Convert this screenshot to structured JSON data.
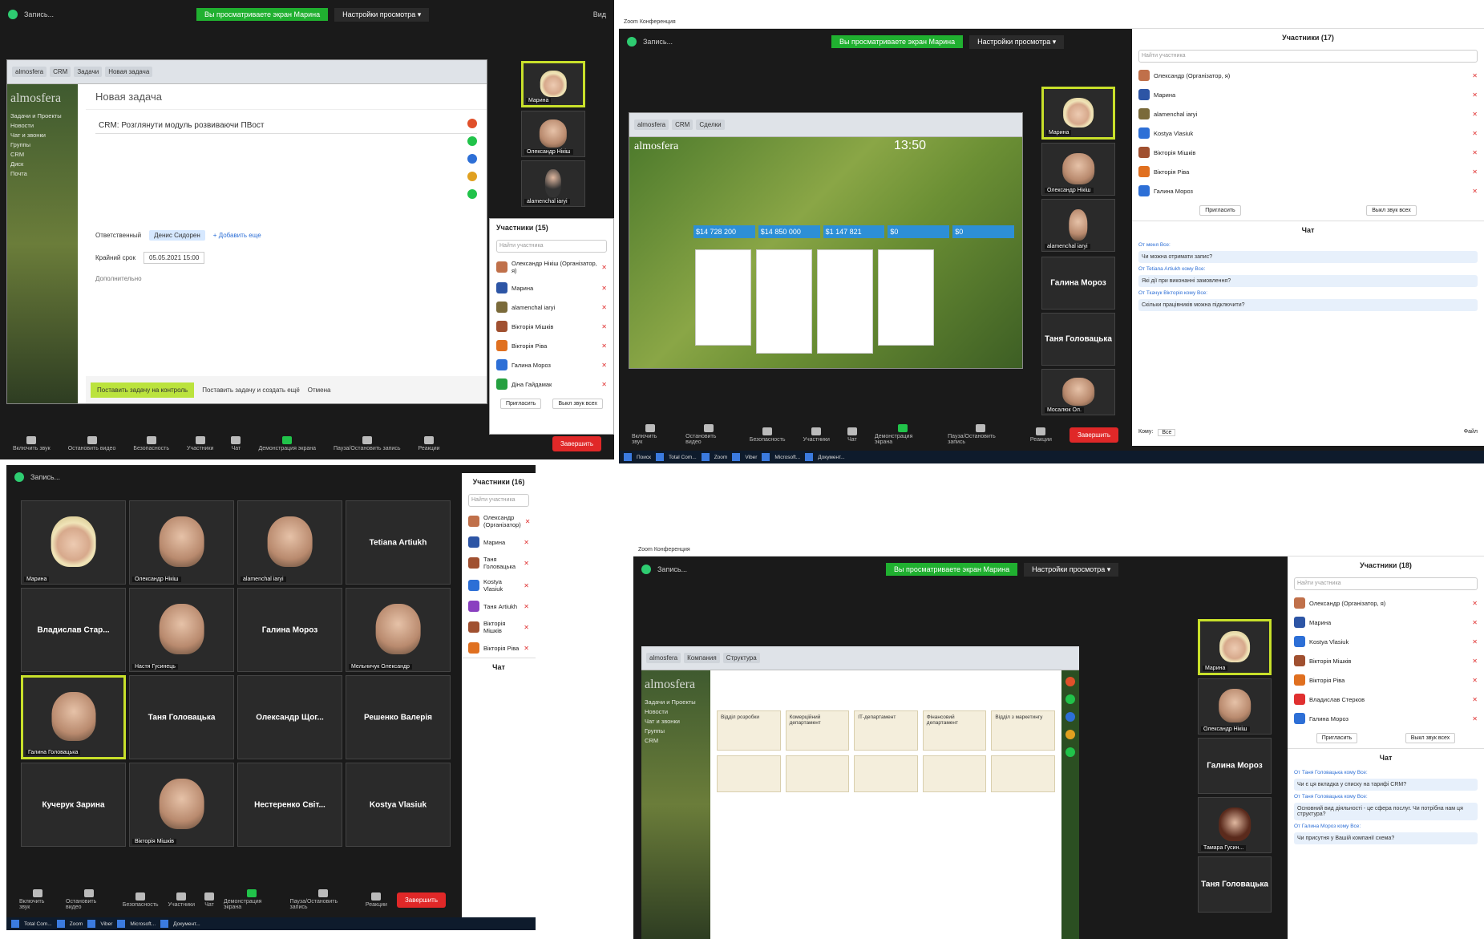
{
  "common": {
    "window_title": "Zoom Конференция",
    "view_banner": "Вы просматриваете экран Марина",
    "view_settings": "Настройки просмотра ▾",
    "view_label": "Вид",
    "recording": "Запись...",
    "end_button": "Завершить",
    "participants_title_17": "Участники (17)",
    "participants_title_16": "Участники (16)",
    "participants_title_18": "Участники (18)",
    "search_placeholder": "Найти участника",
    "invite": "Пригласить",
    "mute_all": "Выкл звук всех",
    "chat_title": "Чат",
    "chat_to": "Кому:",
    "chat_to_value": "Все",
    "chat_file": "Файл",
    "logo": "almosfera",
    "controls": [
      "Включить звук",
      "Остановить видео",
      "Безопасность",
      "Участники",
      "Чат",
      "Демонстрация экрана",
      "Пауза/Остановить запись",
      "Реакции"
    ]
  },
  "tl": {
    "task_header": "Новая задача",
    "task_title": "CRM: Розглянути модуль розвиваючи ПВост",
    "responsible_label": "Ответственный",
    "responsible_value": "Денис Сидорен",
    "add_more": "+ Добавить еще",
    "deadline_label": "Крайний срок",
    "deadline_value": "05.05.2021 15:00",
    "additional": "Дополнительно",
    "save_button": "Поставить задачу на контроль",
    "create_another": "Поставить задачу и создать ещё",
    "cancel": "Отмена",
    "participants_count": "Участники (15)",
    "participants": [
      {
        "name": "Олександр Нікіш (Організатор, я)",
        "color": "#c0704a"
      },
      {
        "name": "Марина",
        "color": "#2d55a5"
      },
      {
        "name": "alamenchal iaryi",
        "color": "#7a6a3a"
      },
      {
        "name": "Вікторія Мішків",
        "color": "#a05030"
      },
      {
        "name": "Вікторія Ріва",
        "color": "#e07020"
      },
      {
        "name": "Галина Мороз",
        "color": "#2d6fd6"
      },
      {
        "name": "Діна Гайдамак",
        "color": "#25a040"
      }
    ],
    "videos": [
      "Марина",
      "Олександр Нікіш",
      "alamenchal iaryi"
    ]
  },
  "tr": {
    "time": "13:50",
    "participants": [
      {
        "name": "Олександр (Організатор, я)",
        "color": "#c0704a"
      },
      {
        "name": "Марина",
        "color": "#2d55a5"
      },
      {
        "name": "alamenchal iaryi",
        "color": "#7a6a3a"
      },
      {
        "name": "Kostya Vlasiuk",
        "color": "#2d6fd6"
      },
      {
        "name": "Вікторія Мішків",
        "color": "#a05030"
      },
      {
        "name": "Вікторія Ріва",
        "color": "#e07020"
      },
      {
        "name": "Галина Мороз",
        "color": "#2d6fd6"
      }
    ],
    "videos": [
      "Марина",
      "Олександр Нікіш",
      "alamenchal iaryi"
    ],
    "tiles": [
      "Галина Мороз",
      "Таня Головацька"
    ],
    "last_video": "Мосалюк Ол.",
    "amounts": [
      "$14 728 200",
      "$14 850 000",
      "$1 147 821",
      "$0",
      "$0"
    ],
    "chat": [
      {
        "meta": "От меня Все:",
        "text": "Чи можна отримати запис?"
      },
      {
        "meta": "От Tetiana Artiukh кому Все:",
        "text": "Які дії при виконанні замовлення?"
      },
      {
        "meta": "От Ткачук Вікторія кому Все:",
        "text": "Скільки працівників можна підключити?"
      }
    ]
  },
  "bl": {
    "grid": [
      {
        "name": "Марина",
        "video": true,
        "blonde": true
      },
      {
        "name": "Олександр Нікіш",
        "video": true
      },
      {
        "name": "alamenchal iaryi",
        "video": true
      },
      {
        "name": "Tetiana Artiukh",
        "video": false
      },
      {
        "name": "Владислав Стар...",
        "video": false
      },
      {
        "name": "Настя Гусинець",
        "video": true
      },
      {
        "name": "Галина Мороз",
        "video": false
      },
      {
        "name": "Мельничук Олександр",
        "video": true
      },
      {
        "name": "Галина Головацька",
        "video": true,
        "active": true
      },
      {
        "name": "Таня Головацька",
        "video": false
      },
      {
        "name": "Олександр Щог...",
        "video": false
      },
      {
        "name": "Решенко Валерія",
        "video": false
      },
      {
        "name": "Кучерук Зарина",
        "video": false
      },
      {
        "name": "Вікторія Мішків",
        "video": true
      },
      {
        "name": "Нестеренко Світ...",
        "video": false
      },
      {
        "name": "Kostya Vlasiuk",
        "video": false
      }
    ],
    "participants": [
      {
        "name": "Олександр (Організатор)",
        "color": "#c0704a"
      },
      {
        "name": "Марина",
        "color": "#2d55a5"
      },
      {
        "name": "Таня Головацька",
        "color": "#a05030"
      },
      {
        "name": "Kostya Vlasiuk",
        "color": "#2d6fd6"
      },
      {
        "name": "Таня Artiukh",
        "color": "#8a40c0"
      },
      {
        "name": "Вікторія Мішків",
        "color": "#a05030"
      },
      {
        "name": "Вікторія Ріва",
        "color": "#e07020"
      }
    ]
  },
  "br": {
    "participants": [
      {
        "name": "Олександр (Організатор, я)",
        "color": "#c0704a"
      },
      {
        "name": "Марина",
        "color": "#2d55a5"
      },
      {
        "name": "Kostya Vlasiuk",
        "color": "#2d6fd6"
      },
      {
        "name": "Вікторія Мішків",
        "color": "#a05030"
      },
      {
        "name": "Вікторія Ріва",
        "color": "#e07020"
      },
      {
        "name": "Владислав Стерков",
        "color": "#e03030"
      },
      {
        "name": "Галина Мороз",
        "color": "#2d6fd6"
      }
    ],
    "videos": [
      "Марина",
      "Олександр Нікіш"
    ],
    "tiles": [
      "Галина Мороз",
      "Таня Головацька"
    ],
    "last_video": "Тамара Гусин...",
    "chat": [
      {
        "meta": "От Таня Головацька кому Все:",
        "text": "Чи є ця вкладка у списку на тарифі CRM?"
      },
      {
        "meta": "От Таня Головацька кому Все:",
        "text": "Основний вид діяльності - це сфера послуг. Чи потрібна нам ця структура?"
      },
      {
        "meta": "От Галина Мороз кому Все:",
        "text": "Чи присутня у Вашій компанії схема?"
      }
    ],
    "org_columns": [
      "Відділ розробки",
      "Комерційний департамент",
      "ІТ-департамент",
      "Фінансовий департамент",
      "Відділ з маркетингу"
    ]
  }
}
